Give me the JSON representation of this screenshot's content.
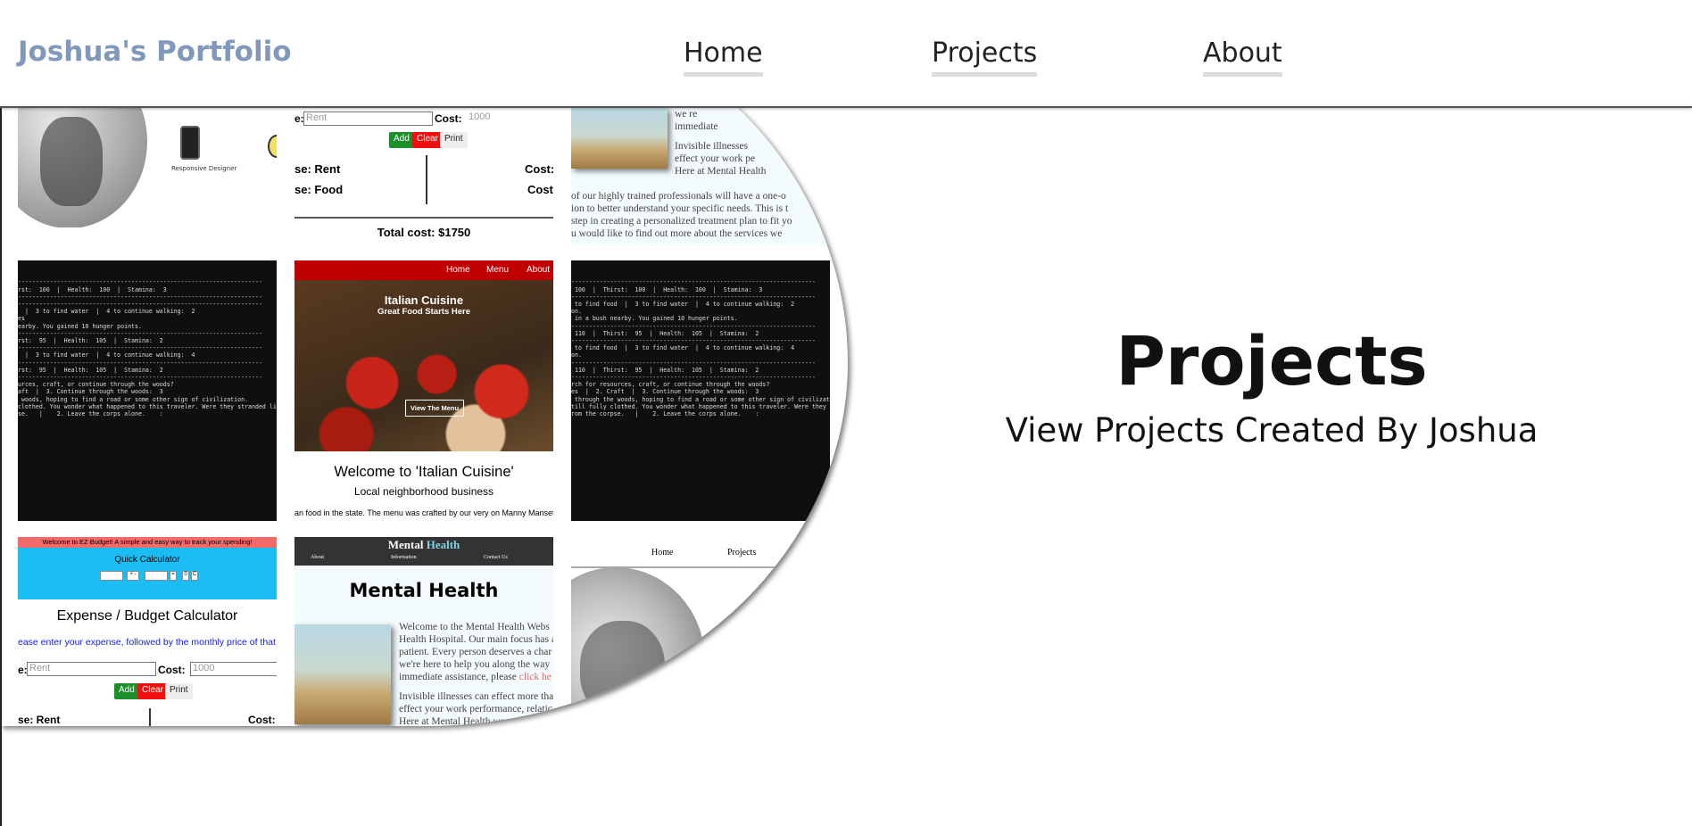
{
  "navbar": {
    "brand": "Joshua's Portfolio",
    "links": [
      "Home",
      "Projects",
      "About"
    ]
  },
  "hero": {
    "title": "Projects",
    "subtitle": "View Projects Created By Joshua"
  },
  "collage": {
    "portfolio_top": {
      "caption": "Responsive Designer"
    },
    "calc_top": {
      "row_label": "e:",
      "rent_placeholder": "Rent",
      "cost_label": "Cost:",
      "cost_placeholder": "1000",
      "add": "Add",
      "clear": "Clear",
      "print": "Print",
      "exp1": "se: Rent",
      "exp2": "se: Food",
      "cost1": "Cost:",
      "cost2": "Cost:",
      "total": "Total cost: $1750"
    },
    "mental_top": {
      "lines_side": [
        "we re",
        "immediate",
        "",
        "Invisible illnesses",
        "effect your work pe",
        "Here at Mental Health"
      ],
      "lines_bottom": [
        "of our highly trained professionals will have a one-o",
        "ion to better understand your specific needs. This is t",
        "step in creating a personalized treatment plan to fit yo",
        "u would like to find out more about the services we"
      ]
    },
    "terminal1": [
      "---------------------------------------------------------------------",
      "rst:  100  |  Health:  100  |  Stamina:  3",
      "---------------------------------------------------------------------",
      "---------------------------------------------------------------------",
      "  |  3 to find water  |  4 to continue walking:  2",
      "",
      "",
      "es",
      "earby. You gained 10 hunger points.",
      "",
      "---------------------------------------------------------------------",
      "rst:  95  |  Health:  105  |  Stamina:  2",
      "---------------------------------------------------------------------",
      "  |  3 to find water  |  4 to continue walking:  4",
      "",
      "",
      "",
      "---------------------------------------------------------------------",
      "rst:  95  |  Health:  105  |  Stamina:  2",
      "---------------------------------------------------------------------",
      "",
      "urces, craft, or continue through the woods?",
      "aft  |  3. Continue through the woods:  3",
      "",
      " woods, hoping to find a road or some other sign of civilization.",
      "",
      "clothed. You wonder what happened to this traveler. Were they stranded like yo",
      "",
      "se.   |    2. Leave the corps alone.    :"
    ],
    "terminal2": [
      "---------------------------------------------------------------------",
      " 100  |  Thirst:  100  |  Health:  100  |  Stamina:  3",
      "---------------------------------------------------------------------",
      " to find food  |  3 to find water  |  4 to continue walking:  2",
      "",
      "on.",
      " in a bush nearby. You gained 10 hunger points.",
      "",
      "---------------------------------------------------------------------",
      " 110  |  Thirst:  95  |  Health:  105  |  Stamina:  2",
      "---------------------------------------------------------------------",
      " to find food  |  3 to find water  |  4 to continue walking:  4",
      "",
      "on.",
      "",
      "---------------------------------------------------------------------",
      " 110  |  Thirst:  95  |  Health:  105  |  Stamina:  2",
      "---------------------------------------------------------------------",
      "",
      "rch for resources, craft, or continue through the woods?",
      "es  |  2. Craft  |  3. Continue through the woods:  3",
      "",
      " through the woods, hoping to find a road or some other sign of civilization.",
      "",
      "till fully clothed. You wonder what happened to this traveler. Were they str",
      "",
      "rom the corpse.   |    2. Leave the corps alone.    :"
    ],
    "italian": {
      "nav": [
        "Home",
        "Menu",
        "About"
      ],
      "title": "Italian Cuisine",
      "tagline": "Great Food Starts Here",
      "menu_button": "View The Menu",
      "welcome": "Welcome to 'Italian Cuisine'",
      "sub": "Local neighborhood business",
      "small": "an food in the state. The menu was crafted by our very on Manny Mansett"
    },
    "budget": {
      "banner": "Welcome to EZ Budget! A simple and easy way to track your spending!",
      "quick": "Quick Calculator",
      "title": "Expense / Budget Calculator",
      "instr": "ease enter your expense, followed by the monthly price of that expen",
      "row_label": "e:",
      "rent_placeholder": "Rent",
      "cost_label": "Cost:",
      "cost_placeholder": "1000",
      "add": "Add",
      "clear": "Clear",
      "print": "Print",
      "exp1": "se: Rent",
      "cost1": "Cost:",
      "mini_ops": [
        "+ -",
        "=",
        "0",
        "C"
      ]
    },
    "mental": {
      "brand_a": "Mental",
      "brand_b": "Health",
      "nav": [
        "About",
        "Information",
        "Contact Us"
      ],
      "big": "Mental Health",
      "lines": [
        "Welcome to the Mental Health Webs",
        "Health Hospital. Our main focus has a",
        "patient. Every person deserves a char",
        "we're here to help you along the way",
        "immediate assistance, please ",
        "",
        "Invisible illnesses can effect more tha",
        "effect your work performance, relatic",
        "Here at Mental Health we can consti"
      ],
      "link": "click he"
    },
    "portfolio_bottom": {
      "nav": [
        "Home",
        "Projects"
      ]
    }
  }
}
